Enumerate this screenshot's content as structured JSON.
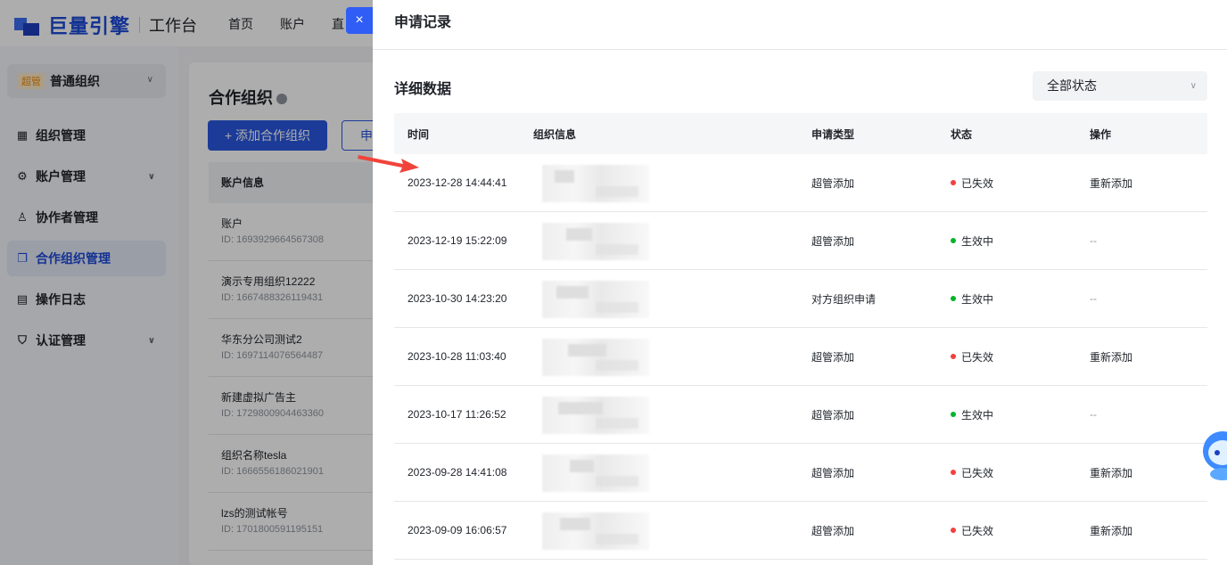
{
  "app": {
    "logo": "巨量引擎",
    "subtitle": "工作台",
    "nav": [
      "首页",
      "账户",
      "直"
    ]
  },
  "sidebar": {
    "org_badge": "超管",
    "org_name": "普通组织",
    "items": [
      {
        "icon": "grid-icon",
        "glyph": "▦",
        "label": "组织管理",
        "chevron": false,
        "active": false
      },
      {
        "icon": "gear-icon",
        "glyph": "⚙",
        "label": "账户管理",
        "chevron": true,
        "active": false
      },
      {
        "icon": "users-icon",
        "glyph": "♙",
        "label": "协作者管理",
        "chevron": false,
        "active": false
      },
      {
        "icon": "copy-icon",
        "glyph": "❐",
        "label": "合作组织管理",
        "chevron": false,
        "active": true
      },
      {
        "icon": "doc-icon",
        "glyph": "▤",
        "label": "操作日志",
        "chevron": false,
        "active": false
      },
      {
        "icon": "shield-icon",
        "glyph": "⛉",
        "label": "认证管理",
        "chevron": true,
        "active": false
      }
    ]
  },
  "content": {
    "title": "合作组织",
    "add_button": "+ 添加合作组织",
    "secondary_button": "申",
    "table_header": "账户信息",
    "rows": [
      {
        "name": "账户",
        "id": "ID: 1693929664567308"
      },
      {
        "name": "演示专用组织12222",
        "id": "ID: 1667488326119431"
      },
      {
        "name": "华东分公司测试2",
        "id": "ID: 1697114076564487"
      },
      {
        "name": "新建虚拟广告主",
        "id": "ID: 1729800904463360"
      },
      {
        "name": "组织名称tesla",
        "id": "ID: 1666556186021901"
      },
      {
        "name": "lzs的测试帐号",
        "id": "ID: 1701800591195151"
      }
    ]
  },
  "drawer": {
    "close_glyph": "×",
    "title": "申请记录",
    "section_title": "详细数据",
    "status_filter": "全部状态",
    "columns": [
      "时间",
      "组织信息",
      "申请类型",
      "状态",
      "操作"
    ],
    "rows": [
      {
        "time": "2023-12-28 14:44:41",
        "type": "超管添加",
        "status": "已失效",
        "status_color": "#f53f3f",
        "action": "重新添加"
      },
      {
        "time": "2023-12-19 15:22:09",
        "type": "超管添加",
        "status": "生效中",
        "status_color": "#00b42a",
        "action": "--"
      },
      {
        "time": "2023-10-30 14:23:20",
        "type": "对方组织申请",
        "status": "生效中",
        "status_color": "#00b42a",
        "action": "--"
      },
      {
        "time": "2023-10-28 11:03:40",
        "type": "超管添加",
        "status": "已失效",
        "status_color": "#f53f3f",
        "action": "重新添加"
      },
      {
        "time": "2023-10-17 11:26:52",
        "type": "超管添加",
        "status": "生效中",
        "status_color": "#00b42a",
        "action": "--"
      },
      {
        "time": "2023-09-28 14:41:08",
        "type": "超管添加",
        "status": "已失效",
        "status_color": "#f53f3f",
        "action": "重新添加"
      },
      {
        "time": "2023-09-09 16:06:57",
        "type": "超管添加",
        "status": "已失效",
        "status_color": "#f53f3f",
        "action": "重新添加"
      }
    ]
  },
  "colors": {
    "brand": "#2a57e0",
    "annotation_arrow": "#f0443a"
  }
}
